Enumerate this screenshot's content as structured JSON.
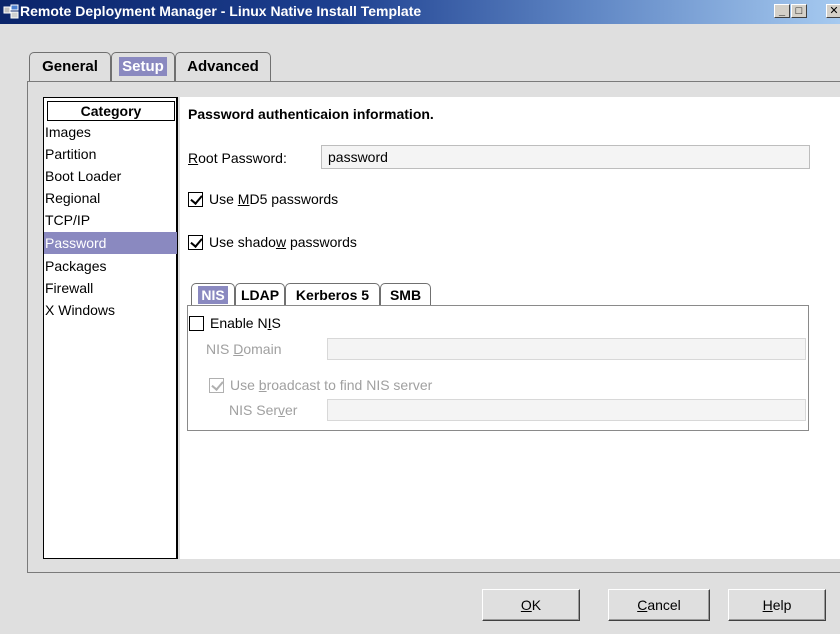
{
  "window": {
    "title": "Remote Deployment Manager - Linux Native Install Template",
    "controls": {
      "minimize": "_",
      "maximize": "□",
      "close": "✕"
    }
  },
  "main_tabs": [
    {
      "label": "General",
      "selected": false
    },
    {
      "label": "Setup",
      "selected": true
    },
    {
      "label": "Advanced",
      "selected": false
    }
  ],
  "category": {
    "header": "Category",
    "items": [
      {
        "label": "Images"
      },
      {
        "label": "Partition"
      },
      {
        "label": "Boot Loader"
      },
      {
        "label": "Regional"
      },
      {
        "label": "TCP/IP"
      },
      {
        "label": "Password",
        "selected": true
      },
      {
        "label": "Packages"
      },
      {
        "label": "Firewall"
      },
      {
        "label": "X Windows"
      }
    ]
  },
  "password": {
    "heading": "Password authenticaion information.",
    "root_label_pre": "R",
    "root_label_post": "oot Password:",
    "root_value": "password",
    "md5_pre": "Use ",
    "md5_u": "M",
    "md5_post": "D5 passwords",
    "md5_checked": true,
    "shadow_pre": "Use shado",
    "shadow_u": "w",
    "shadow_post": " passwords",
    "shadow_checked": true
  },
  "sub_tabs": [
    {
      "label": "NIS",
      "selected": true
    },
    {
      "label": "LDAP"
    },
    {
      "label": "Kerberos 5"
    },
    {
      "label": "SMB"
    }
  ],
  "nis": {
    "enable_pre": "Enable N",
    "enable_u": "I",
    "enable_post": "S",
    "enable_checked": false,
    "domain_pre": "NIS ",
    "domain_u": "D",
    "domain_post": "omain",
    "broadcast_pre": "Use ",
    "broadcast_u": "b",
    "broadcast_post": "roadcast to find NIS server",
    "broadcast_checked": true,
    "server_pre": "NIS Ser",
    "server_u": "v",
    "server_post": "er"
  },
  "buttons": {
    "ok_u": "O",
    "ok_post": "K",
    "cancel_u": "C",
    "cancel_post": "ancel",
    "help_u": "H",
    "help_post": "elp"
  }
}
